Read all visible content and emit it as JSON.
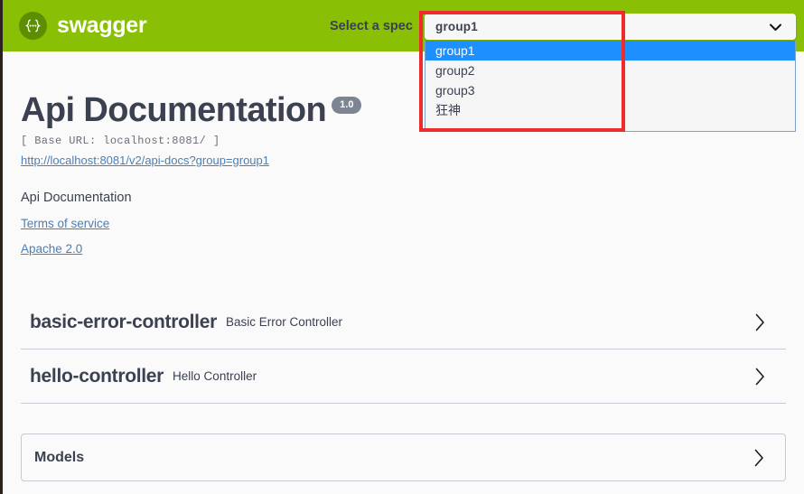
{
  "topbar": {
    "logo_icon": "swagger-braces-icon",
    "logo_text": "swagger",
    "spec_label": "Select a spec"
  },
  "spec_select": {
    "name": "spec-select",
    "selected_value": "group1",
    "caret_icon": "chevron-down-icon",
    "expanded": true,
    "options": [
      {
        "label": "group1",
        "selected": true
      },
      {
        "label": "group2",
        "selected": false
      },
      {
        "label": "group3",
        "selected": false
      },
      {
        "label": "狂神",
        "selected": false
      }
    ]
  },
  "annotation": {
    "type": "red-highlight-rectangle",
    "color": "#f02b2b"
  },
  "info": {
    "title": "Api Documentation",
    "version": "1.0",
    "base_url": "[ Base URL: localhost:8081/ ]",
    "docs_link": "http://localhost:8081/v2/api-docs?group=group1",
    "description": "Api Documentation",
    "terms_of_service": "Terms of service",
    "license": "Apache 2.0"
  },
  "tags": [
    {
      "name": "basic-error-controller",
      "description": "Basic Error Controller",
      "arrow_icon": "chevron-right-icon"
    },
    {
      "name": "hello-controller",
      "description": "Hello Controller",
      "arrow_icon": "chevron-right-icon"
    }
  ],
  "models": {
    "title": "Models",
    "arrow_icon": "chevron-right-icon"
  },
  "colors": {
    "brand_green": "#89bf04",
    "logo_green": "#5b8f00",
    "text_dark": "#3b4151",
    "link_blue": "#4a7fb5",
    "highlight_blue": "#1e8fff",
    "annotation_red": "#f02b2b",
    "badge_gray": "#7d8492"
  }
}
